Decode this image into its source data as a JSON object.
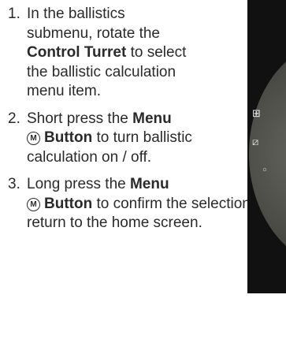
{
  "steps": [
    {
      "number": "1.",
      "before": "In the ballistics submenu, rotate the ",
      "bold": "Control Turret",
      "after": " to select the ballistic calculation menu item."
    },
    {
      "number": "2.",
      "before": "Short press the ",
      "bold": "Menu",
      "icon": "M",
      "bold2": "Button",
      "after": " to turn ballistic calculation on / off."
    },
    {
      "number": "3.",
      "before": "Long press the ",
      "bold": "Menu",
      "icon": "M",
      "bold2": "Button",
      "after": " to confirm the selection and return to the home screen."
    }
  ],
  "illustration": {
    "glyphs": [
      "⊞",
      "⧄",
      "◦"
    ],
    "colors": {
      "device": "#111111",
      "screen": "#55554f"
    }
  }
}
